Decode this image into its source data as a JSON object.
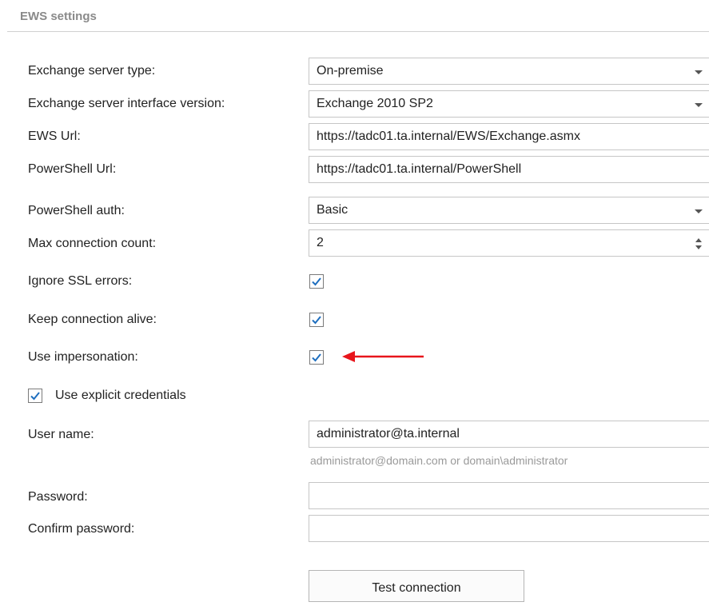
{
  "section": {
    "title": "EWS settings"
  },
  "fields": {
    "server_type": {
      "label": "Exchange server type:",
      "value": "On-premise"
    },
    "interface_version": {
      "label": "Exchange server interface version:",
      "value": "Exchange 2010 SP2"
    },
    "ews_url": {
      "label": "EWS Url:",
      "value": "https://tadc01.ta.internal/EWS/Exchange.asmx"
    },
    "powershell_url": {
      "label": "PowerShell Url:",
      "value": "https://tadc01.ta.internal/PowerShell"
    },
    "powershell_auth": {
      "label": "PowerShell auth:",
      "value": "Basic"
    },
    "max_connection_count": {
      "label": "Max connection count:",
      "value": "2"
    },
    "ignore_ssl_errors": {
      "label": "Ignore SSL errors:",
      "checked": true
    },
    "keep_connection_alive": {
      "label": "Keep connection alive:",
      "checked": true
    },
    "use_impersonation": {
      "label": "Use impersonation:",
      "checked": true
    },
    "use_explicit_credentials": {
      "label": "Use explicit credentials",
      "checked": true
    },
    "user_name": {
      "label": "User name:",
      "value": "administrator@ta.internal",
      "hint": "administrator@domain.com or domain\\administrator"
    },
    "password": {
      "label": "Password:",
      "value": ""
    },
    "confirm_password": {
      "label": "Confirm password:",
      "value": ""
    }
  },
  "buttons": {
    "test_connection": "Test connection"
  },
  "colors": {
    "accent": "#1f6fbf",
    "annotation_arrow": "#e8151b"
  },
  "icons": {
    "checkbox_check": "check-icon",
    "dropdown": "chevron-down-icon",
    "annotation": "red-arrow-icon"
  }
}
